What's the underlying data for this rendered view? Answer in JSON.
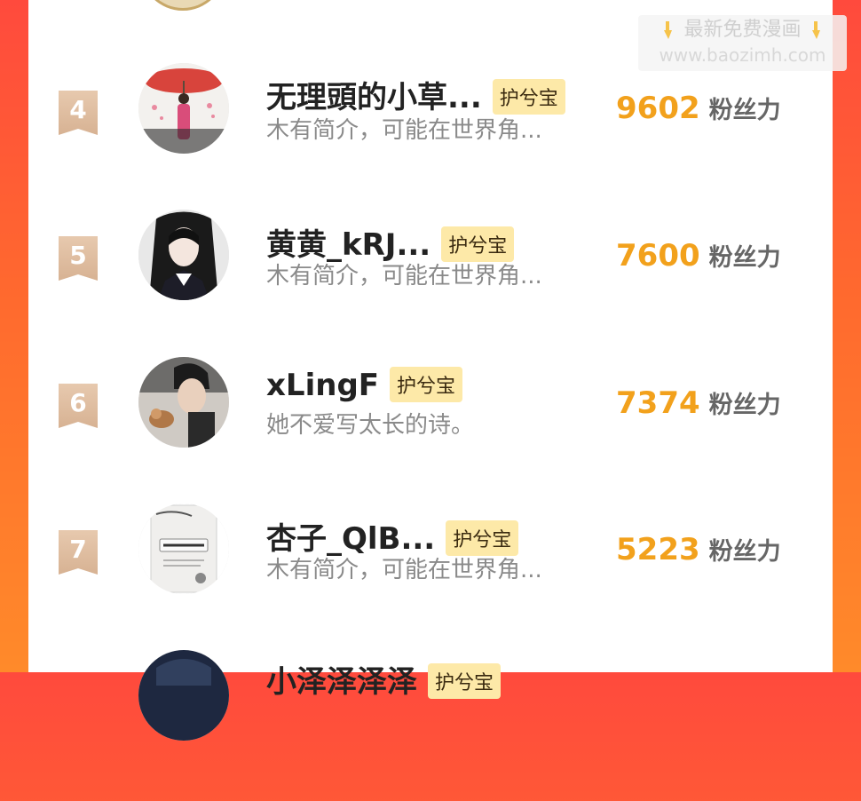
{
  "colors": {
    "accent_orange": "#f2a11c",
    "badge_bg": "#fde9a8",
    "rank_bg": "#dcb796",
    "bg_gradient_start": "#ff4a3d",
    "bg_gradient_end": "#ff8a2a"
  },
  "watermark": {
    "line1": "最新免费漫画",
    "line2": "www.baozimh.com",
    "icon": "pointing-down-hand-icon"
  },
  "rows": [
    {
      "rank": "4",
      "name": "无理頭的小草...",
      "badge": "护兮宝",
      "bio": "木有简介，可能在世界角...",
      "score": "9602",
      "score_unit": "粉丝力"
    },
    {
      "rank": "5",
      "name": "黄黄_kRJ...",
      "badge": "护兮宝",
      "bio": "木有简介，可能在世界角...",
      "score": "7600",
      "score_unit": "粉丝力"
    },
    {
      "rank": "6",
      "name": "xLingF",
      "badge": "护兮宝",
      "bio": "她不爱写太长的诗。",
      "score": "7374",
      "score_unit": "粉丝力"
    },
    {
      "rank": "7",
      "name": "杏子_QlB...",
      "badge": "护兮宝",
      "bio": "木有简介，可能在世界角...",
      "score": "5223",
      "score_unit": "粉丝力"
    },
    {
      "rank": "",
      "name": "小泽泽泽泽",
      "badge": "护兮宝",
      "bio": "",
      "score": "",
      "score_unit": ""
    }
  ]
}
